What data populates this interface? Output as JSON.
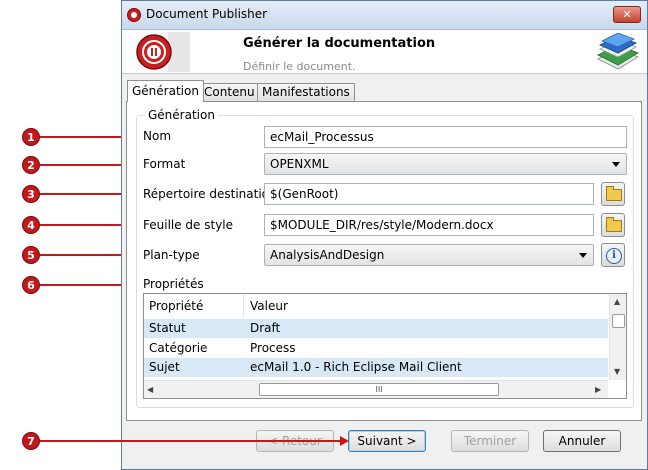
{
  "window": {
    "title": "Document Publisher",
    "close_glyph": "✕"
  },
  "header": {
    "title": "Générer la documentation",
    "subtitle": "Définir le document."
  },
  "tabs": [
    {
      "label": "Génération",
      "active": true
    },
    {
      "label": "Contenu",
      "active": false
    },
    {
      "label": "Manifestations",
      "active": false
    }
  ],
  "group": {
    "legend": "Génération"
  },
  "form": {
    "nom": {
      "label": "Nom",
      "value": "ecMail_Processus"
    },
    "format": {
      "label": "Format",
      "value": "OPENXML"
    },
    "repertoire": {
      "label": "Répertoire destination",
      "value": "$(GenRoot)"
    },
    "feuille": {
      "label": "Feuille de style",
      "value": "$MODULE_DIR/res/style/Modern.docx"
    },
    "plan": {
      "label": "Plan-type",
      "value": "AnalysisAndDesign"
    },
    "proprietes": {
      "label": "Propriétés"
    }
  },
  "properties_table": {
    "headers": [
      "Propriété",
      "Valeur"
    ],
    "rows": [
      [
        "Statut",
        "Draft"
      ],
      [
        "Catégorie",
        "Process"
      ],
      [
        "Sujet",
        "ecMail 1.0 - Rich Eclipse Mail Client"
      ]
    ],
    "scroll_grip": "III"
  },
  "buttons": {
    "back": "< Retour",
    "next": "Suivant >",
    "finish": "Terminer",
    "cancel": "Annuler"
  },
  "callouts": [
    "1",
    "2",
    "3",
    "4",
    "5",
    "6",
    "7"
  ],
  "colors": {
    "callout": "#c1191c",
    "title_gradient_top": "#e6eef8",
    "selected_row": "#d9e8f7"
  }
}
